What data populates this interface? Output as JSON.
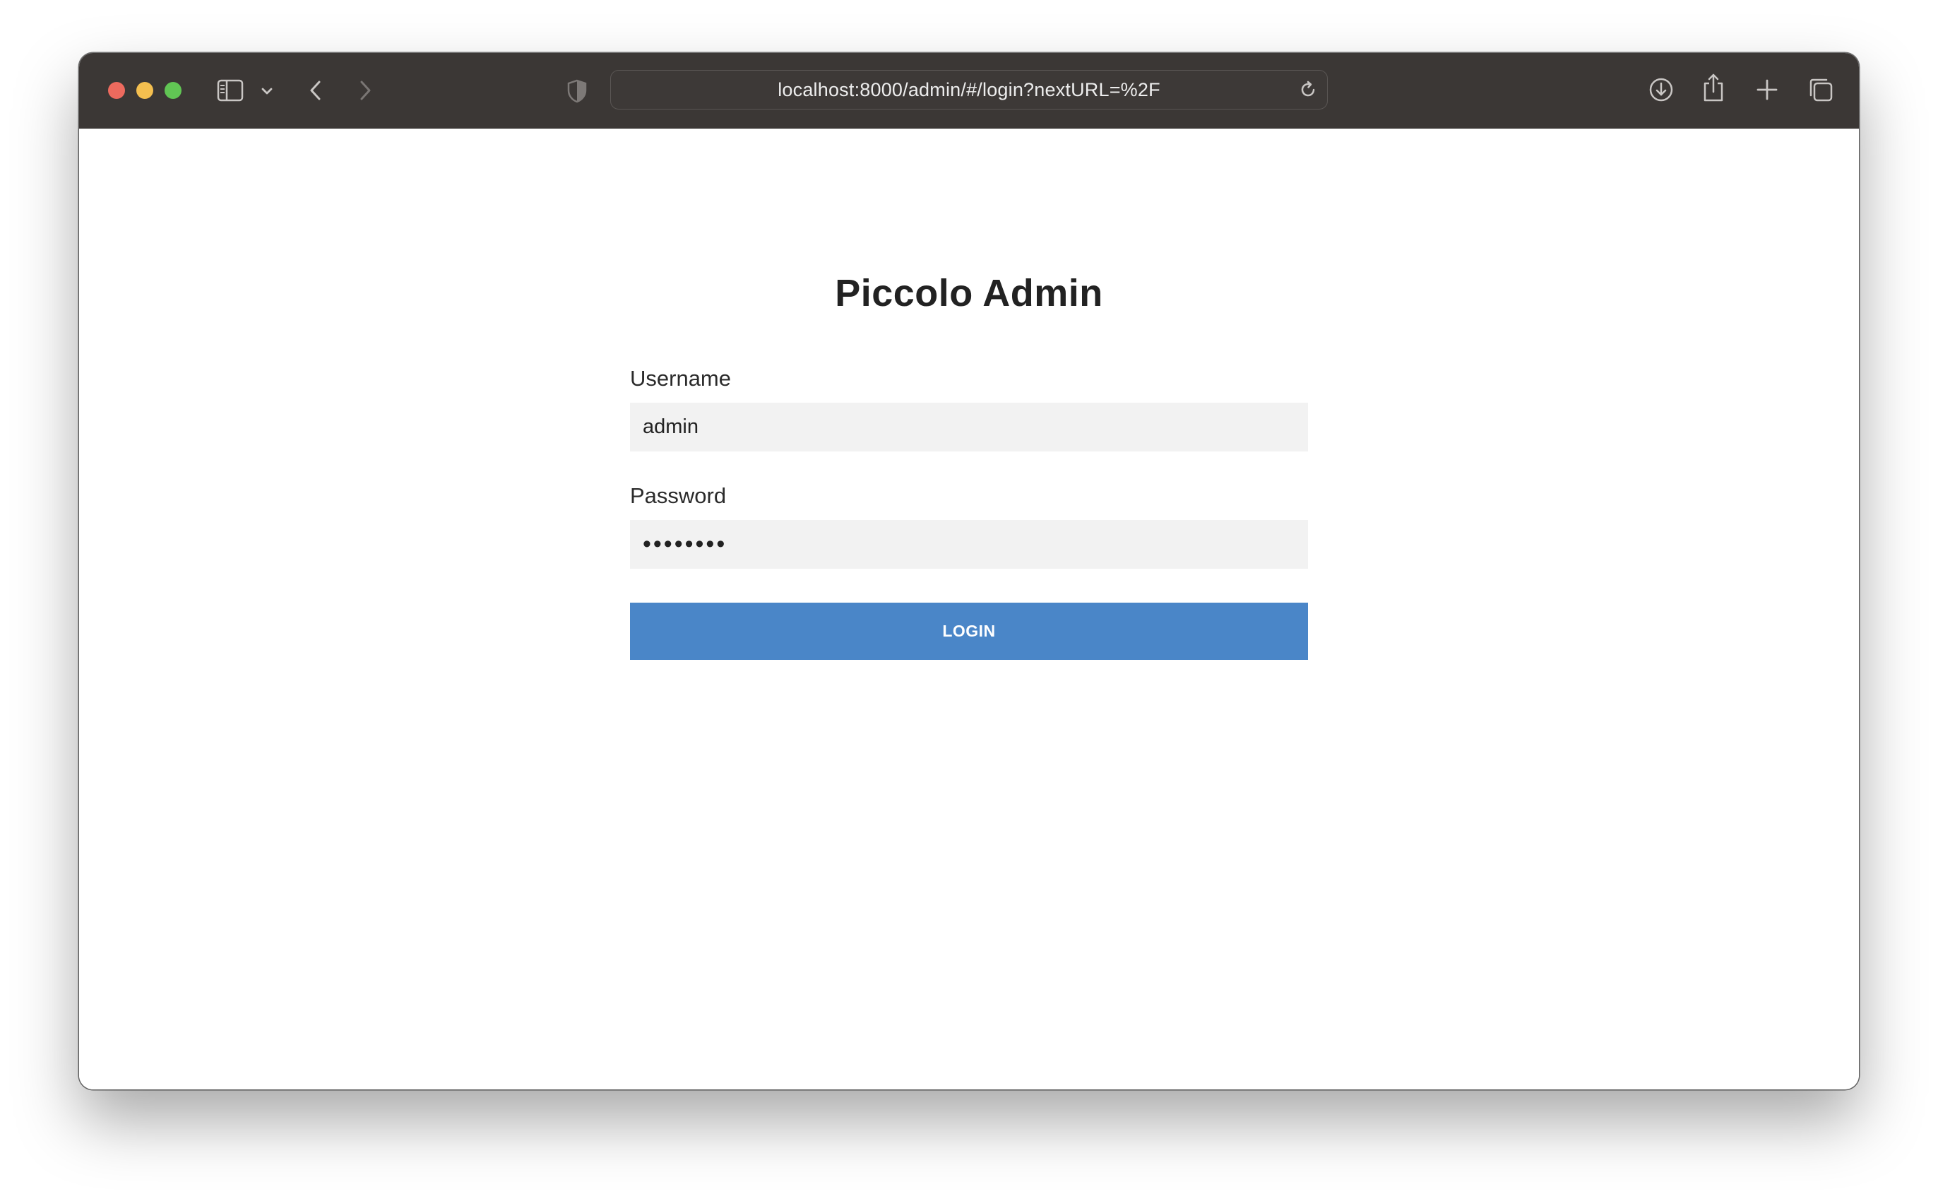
{
  "browser": {
    "url": "localhost:8000/admin/#/login?nextURL=%2F",
    "toolbar_icons": [
      "sidebar-icon",
      "chevron-down-icon",
      "back-icon",
      "forward-icon",
      "privacy-shield-icon",
      "reload-icon",
      "download-icon",
      "share-icon",
      "new-tab-icon",
      "tab-overview-icon"
    ]
  },
  "login": {
    "title": "Piccolo Admin",
    "username_label": "Username",
    "username_value": "admin",
    "password_label": "Password",
    "password_value": "••••••••",
    "button_label": "LOGIN"
  },
  "colors": {
    "titlebar": "#3b3735",
    "button": "#4a86c8",
    "input_bg": "#f2f2f2"
  }
}
